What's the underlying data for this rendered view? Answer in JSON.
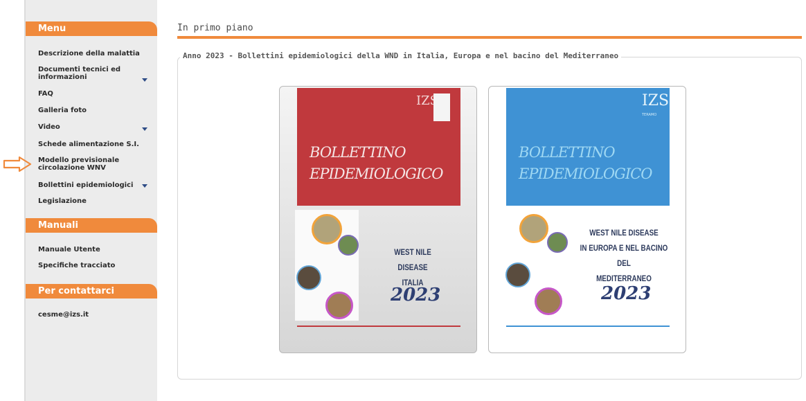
{
  "sidebar": {
    "menu_title": "Menu",
    "menu_items": [
      "Descrizione della malattia",
      "Documenti tecnici ed informazioni",
      "FAQ",
      "Galleria foto",
      "Video",
      "Schede alimentazione S.I.",
      "Modello previsionale circolazione WNV",
      "Bollettini epidemiologici",
      "Legislazione"
    ],
    "manuals_title": "Manuali",
    "manual_items": [
      "Manuale Utente",
      "Specifiche tracciato"
    ],
    "contact_title": "Per contattarci",
    "contact_email": "cesme@izs.it"
  },
  "main": {
    "title": "In primo piano",
    "legend": "Anno 2023 - Bollettini epidemiologici della WND in Italia, Europa e nel bacino del Mediterraneo",
    "cards": [
      {
        "cover_title_1": "BOLLETTINO",
        "cover_title_2": "EPIDEMIOLOGICO",
        "logo": "IZS",
        "line1": "WEST NILE DISEASE",
        "line2": "ITALIA",
        "year": "2023",
        "color": "#c0393d"
      },
      {
        "cover_title_1": "BOLLETTINO",
        "cover_title_2": "EPIDEMIOLOGICO",
        "logo": "IZS",
        "logo_sub": "TERAMO",
        "line1": "WEST NILE DISEASE",
        "line2": "IN EUROPA E NEL BACINO DEL",
        "line3": "MEDITERRANEO",
        "year": "2023",
        "color": "#3f92d4"
      }
    ]
  },
  "colors": {
    "accent": "#f08a3c",
    "sidebar_bg": "#ececec",
    "caret": "#2e4c86"
  }
}
